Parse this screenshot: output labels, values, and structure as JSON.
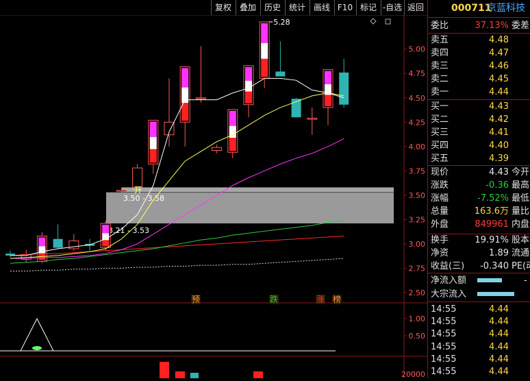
{
  "toolbar": {
    "items": [
      "复权",
      "叠加",
      "历史",
      "统计",
      "画线",
      "F10",
      "标记",
      "-自选",
      "返回"
    ]
  },
  "stock": {
    "code": "000711",
    "name": "京蓝科技"
  },
  "order_book": {
    "ratio_label": "委比",
    "ratio_value": "37.13%",
    "ratio_right": "委差",
    "asks": [
      {
        "label": "卖五",
        "price": "4.48"
      },
      {
        "label": "卖四",
        "price": "4.47"
      },
      {
        "label": "卖三",
        "price": "4.46"
      },
      {
        "label": "卖二",
        "price": "4.45"
      },
      {
        "label": "卖一",
        "price": "4.44"
      }
    ],
    "bids": [
      {
        "label": "买一",
        "price": "4.43"
      },
      {
        "label": "买二",
        "price": "4.42"
      },
      {
        "label": "买三",
        "price": "4.41"
      },
      {
        "label": "买四",
        "price": "4.40"
      },
      {
        "label": "买五",
        "price": "4.39"
      }
    ]
  },
  "quote": [
    {
      "label": "现价",
      "value": "4.43",
      "right": "今开",
      "color": "#e6e6e6"
    },
    {
      "label": "涨跌",
      "value": "-0.36",
      "right": "最高",
      "color": "#2ecc40"
    },
    {
      "label": "涨幅",
      "value": "-7.52%",
      "right": "最低",
      "color": "#2ecc40"
    },
    {
      "label": "总量",
      "value": "163.6万",
      "right": "量比",
      "color": "#ffd84a"
    },
    {
      "label": "外盘",
      "value": "849961",
      "right": "内盘",
      "color": "#ff3b3b"
    }
  ],
  "fundamentals": [
    {
      "label": "换手",
      "value": "19.91%",
      "right": "股本"
    },
    {
      "label": "净资",
      "value": "1.89",
      "right": "流通"
    },
    {
      "label": "收益(三)",
      "value": "-0.340",
      "right": "PE(动"
    }
  ],
  "flows": [
    {
      "label": "净流入额",
      "value": "-"
    },
    {
      "label": "大宗流入",
      "value": ""
    }
  ],
  "ticks": [
    {
      "time": "14:55",
      "price": "4.44"
    },
    {
      "time": "14:55",
      "price": "4.44"
    },
    {
      "time": "14:55",
      "price": "4.44"
    },
    {
      "time": "14:55",
      "price": "4.44"
    },
    {
      "time": "14:55",
      "price": "4.44"
    },
    {
      "time": "14:55",
      "price": "4.44"
    }
  ],
  "chart_data": {
    "type": "candlestick",
    "y_ticks": [
      5.0,
      4.75,
      4.5,
      4.25,
      4.0,
      3.75,
      3.5,
      3.25,
      3.0,
      2.75,
      2.5
    ],
    "ylim": [
      2.45,
      5.35
    ],
    "candles": [
      {
        "o": 2.9,
        "h": 2.93,
        "l": 2.86,
        "c": 2.88
      },
      {
        "o": 2.84,
        "h": 2.94,
        "l": 2.81,
        "c": 2.89
      },
      {
        "o": 2.82,
        "h": 3.12,
        "l": 2.8,
        "c": 3.08
      },
      {
        "o": 3.05,
        "h": 3.2,
        "l": 2.95,
        "c": 2.96
      },
      {
        "o": 2.95,
        "h": 3.1,
        "l": 2.93,
        "c": 3.03
      },
      {
        "o": 3.0,
        "h": 3.05,
        "l": 2.93,
        "c": 2.98
      },
      {
        "o": 2.96,
        "h": 3.24,
        "l": 2.93,
        "c": 3.21
      },
      {
        "o": 3.55,
        "h": 3.58,
        "l": 3.49,
        "c": 3.55
      },
      {
        "o": 3.58,
        "h": 3.82,
        "l": 3.55,
        "c": 3.78
      },
      {
        "o": 3.82,
        "h": 4.27,
        "l": 3.72,
        "c": 4.27
      },
      {
        "o": 4.12,
        "h": 4.7,
        "l": 4.0,
        "c": 4.25
      },
      {
        "o": 4.25,
        "h": 4.82,
        "l": 4.0,
        "c": 4.82
      },
      {
        "o": 4.5,
        "h": 5.03,
        "l": 4.45,
        "c": 4.5
      },
      {
        "o": 3.96,
        "h": 4.02,
        "l": 3.93,
        "c": 3.99
      },
      {
        "o": 3.94,
        "h": 4.38,
        "l": 3.88,
        "c": 4.38
      },
      {
        "o": 4.43,
        "h": 4.83,
        "l": 4.3,
        "c": 4.83
      },
      {
        "o": 4.7,
        "h": 5.28,
        "l": 4.6,
        "c": 5.28
      },
      {
        "o": 4.77,
        "h": 5.08,
        "l": 4.75,
        "c": 4.72
      },
      {
        "o": 4.49,
        "h": 4.5,
        "l": 4.3,
        "c": 4.3
      },
      {
        "o": 4.29,
        "h": 4.4,
        "l": 4.12,
        "c": 4.29
      },
      {
        "o": 4.4,
        "h": 4.78,
        "l": 4.22,
        "c": 4.79
      },
      {
        "o": 4.76,
        "h": 4.9,
        "l": 4.4,
        "c": 4.43
      }
    ],
    "ma5": [
      2.88,
      2.88,
      2.92,
      2.95,
      2.97,
      2.99,
      3.05,
      3.15,
      3.3,
      3.6,
      4.15,
      4.48,
      4.48,
      4.48,
      4.55,
      4.6,
      4.7,
      4.7,
      4.68,
      4.58,
      4.55,
      4.5
    ],
    "ma10": [
      2.85,
      2.86,
      2.87,
      2.88,
      2.9,
      2.92,
      2.95,
      3.05,
      3.2,
      3.45,
      3.65,
      3.85,
      3.95,
      4.05,
      4.12,
      4.22,
      4.32,
      4.4,
      4.46,
      4.52,
      4.55,
      4.52
    ],
    "ma20": [
      2.85,
      2.85,
      2.86,
      2.86,
      2.87,
      2.88,
      2.9,
      2.94,
      3.0,
      3.1,
      3.2,
      3.3,
      3.4,
      3.5,
      3.6,
      3.68,
      3.75,
      3.82,
      3.88,
      3.93,
      4.0,
      4.08
    ],
    "ma30": [
      2.8,
      2.81,
      2.82,
      2.84,
      2.85,
      2.87,
      2.89,
      2.91,
      2.93,
      2.95,
      2.98,
      3.01,
      3.04,
      3.06,
      3.09,
      3.11,
      3.13,
      3.15,
      3.17,
      3.19,
      3.22,
      3.24
    ],
    "ma60": [
      2.88,
      2.89,
      2.9,
      2.9,
      2.91,
      2.92,
      2.93,
      2.94,
      2.95,
      2.96,
      2.97,
      2.98,
      2.99,
      3.0,
      3.01,
      3.02,
      3.03,
      3.04,
      3.05,
      3.06,
      3.07,
      3.08
    ],
    "ma120": [
      2.72,
      2.72,
      2.73,
      2.73,
      2.74,
      2.74,
      2.75,
      2.75,
      2.76,
      2.76,
      2.77,
      2.77,
      2.78,
      2.78,
      2.79,
      2.79,
      2.8,
      2.81,
      2.82,
      2.83,
      2.84,
      2.85
    ],
    "zones": [
      {
        "from": 3.21,
        "to": 3.53,
        "label": "3.21 - 3.53"
      },
      {
        "from": 3.5,
        "to": 3.58,
        "label": "3.50 - 3.58"
      }
    ],
    "peak_label": "5.28",
    "markers": [
      {
        "text": "预",
        "color": "#ff9a3c"
      },
      {
        "text": "跌",
        "color": "#2ecc40"
      },
      {
        "text": "涨",
        "color": "#ff3b3b"
      },
      {
        "text": "榜",
        "color": "#ff9a3c"
      }
    ],
    "kai_label": "开",
    "pane2_ticks": [
      "1.00",
      "0.50"
    ],
    "pane3_tick": "20000"
  }
}
